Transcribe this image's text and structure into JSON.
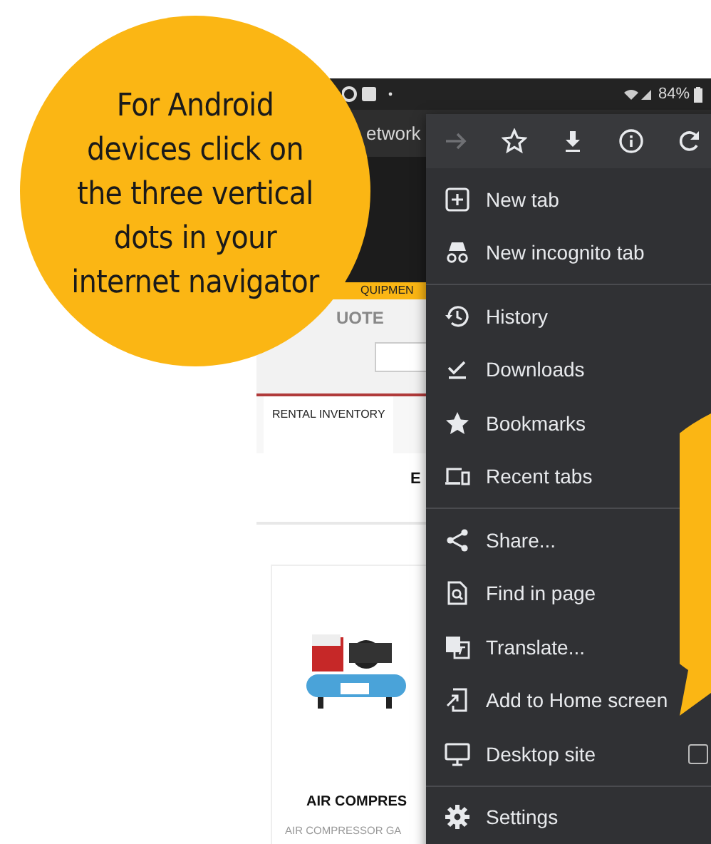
{
  "callout": {
    "lines": [
      "For Android",
      "devices click on",
      "the three vertical",
      "dots in your",
      "internet navigator"
    ]
  },
  "status_bar": {
    "battery": "84%"
  },
  "page": {
    "address": "etwork",
    "nav_label": "QUIPMEN",
    "quote_heading": "UOTE",
    "tab": "RENTAL INVENTORY",
    "heading": "E",
    "product_title": "AIR COMPRES",
    "product_subtitle": "AIR COMPRESSOR GA"
  },
  "menu": {
    "toolbar": [
      {
        "kind": "forward",
        "disabled": true
      },
      {
        "kind": "bookmark",
        "disabled": false
      },
      {
        "kind": "download",
        "disabled": false
      },
      {
        "kind": "info",
        "disabled": false
      },
      {
        "kind": "reload",
        "disabled": false
      }
    ],
    "sections": [
      [
        {
          "kind": "new-tab",
          "label": "New tab"
        },
        {
          "kind": "incognito",
          "label": "New incognito tab"
        }
      ],
      [
        {
          "kind": "history",
          "label": "History"
        },
        {
          "kind": "downloads",
          "label": "Downloads"
        },
        {
          "kind": "bookmarks",
          "label": "Bookmarks"
        },
        {
          "kind": "recent",
          "label": "Recent tabs"
        }
      ],
      [
        {
          "kind": "share",
          "label": "Share..."
        },
        {
          "kind": "find",
          "label": "Find in page"
        },
        {
          "kind": "translate",
          "label": "Translate..."
        },
        {
          "kind": "add-home",
          "label": "Add to Home screen"
        },
        {
          "kind": "desktop",
          "label": "Desktop site",
          "checked": false
        }
      ],
      [
        {
          "kind": "settings",
          "label": "Settings"
        }
      ]
    ]
  }
}
